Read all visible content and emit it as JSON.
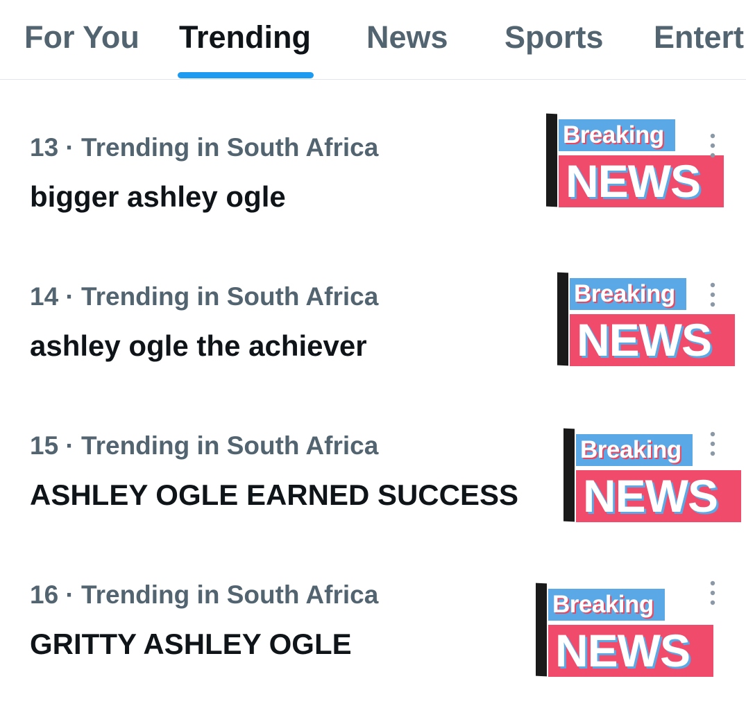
{
  "tabs": [
    {
      "label": "For You"
    },
    {
      "label": "Trending"
    },
    {
      "label": "News"
    },
    {
      "label": "Sports"
    },
    {
      "label": "Entert"
    }
  ],
  "active_tab": "Trending",
  "trends": [
    {
      "meta": "13 · Trending in South Africa",
      "title": "bigger ashley ogle",
      "thumbnail": {
        "line1": "Breaking",
        "line2": "NEWS"
      }
    },
    {
      "meta": "14 · Trending in South Africa",
      "title": "ashley ogle the achiever",
      "thumbnail": {
        "line1": "Breaking",
        "line2": "NEWS"
      }
    },
    {
      "meta": "15 · Trending in South Africa",
      "title": "ASHLEY OGLE EARNED SUCCESS",
      "thumbnail": {
        "line1": "Breaking",
        "line2": "NEWS"
      }
    },
    {
      "meta": "16 · Trending in South Africa",
      "title": "GRITTY ASHLEY OGLE",
      "thumbnail": {
        "line1": "Breaking",
        "line2": "NEWS"
      }
    }
  ],
  "icons": {
    "more": "more-vertical-icon"
  },
  "colors": {
    "accent": "#1d9bf0",
    "primary_text": "#0f1419",
    "secondary_text": "#536471",
    "breaking_bg": "#5aa9e6",
    "news_bg": "#f04b6a"
  }
}
